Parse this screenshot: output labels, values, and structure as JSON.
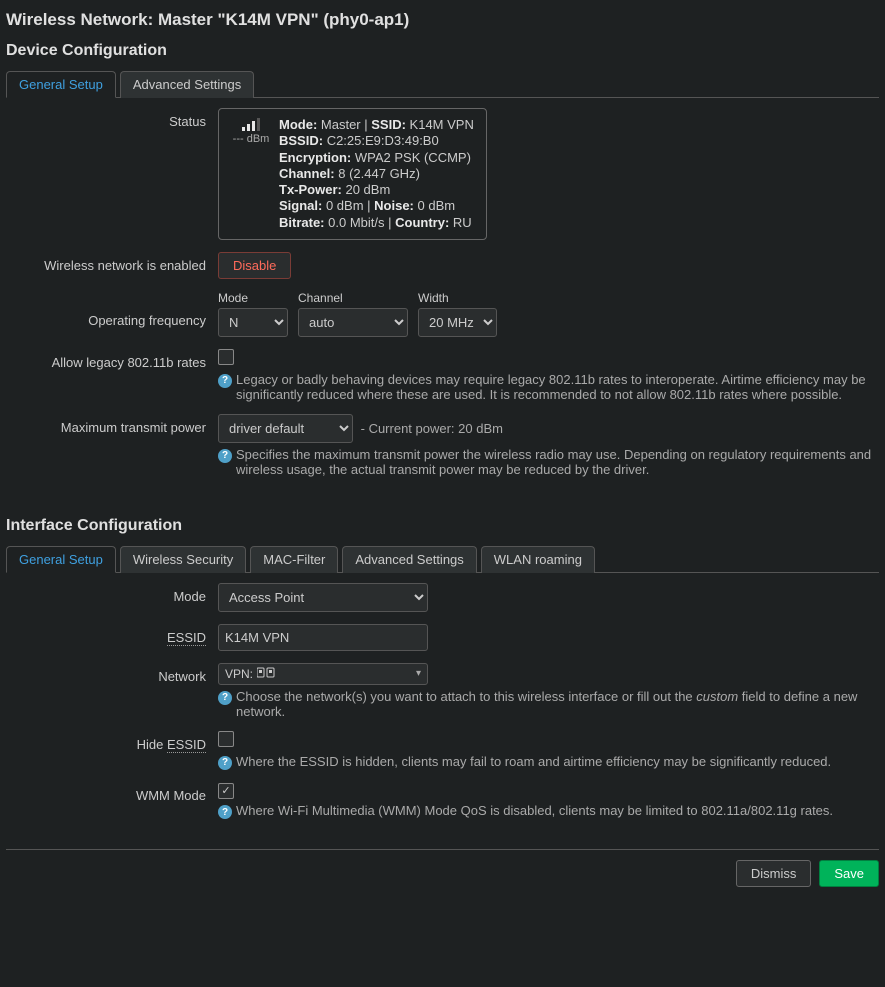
{
  "page": {
    "title": "Wireless Network: Master \"K14M VPN\" (phy0-ap1)"
  },
  "device": {
    "heading": "Device Configuration",
    "tabs": {
      "general": "General Setup",
      "advanced": "Advanced Settings"
    },
    "status": {
      "label": "Status",
      "signal_text": "--- dBm",
      "mode_k": "Mode:",
      "mode_v": "Master",
      "ssid_k": "SSID:",
      "ssid_v": "K14M VPN",
      "bssid_k": "BSSID:",
      "bssid_v": "C2:25:E9:D3:49:B0",
      "enc_k": "Encryption:",
      "enc_v": "WPA2 PSK (CCMP)",
      "chan_k": "Channel:",
      "chan_v": "8 (2.447 GHz)",
      "txp_k": "Tx-Power:",
      "txp_v": "20 dBm",
      "sig_k": "Signal:",
      "sig_v": "0 dBm",
      "noise_k": "Noise:",
      "noise_v": "0 dBm",
      "bit_k": "Bitrate:",
      "bit_v": "0.0 Mbit/s",
      "country_k": "Country:",
      "country_v": "RU"
    },
    "enabled": {
      "label": "Wireless network is enabled",
      "button": "Disable"
    },
    "freq": {
      "label": "Operating frequency",
      "mode_label": "Mode",
      "mode_value": "N",
      "channel_label": "Channel",
      "channel_value": "auto",
      "width_label": "Width",
      "width_value": "20 MHz"
    },
    "legacy": {
      "label": "Allow legacy 802.11b rates",
      "checked": false,
      "help": "Legacy or badly behaving devices may require legacy 802.11b rates to interoperate. Airtime efficiency may be significantly reduced where these are used. It is recommended to not allow 802.11b rates where possible."
    },
    "txpower": {
      "label": "Maximum transmit power",
      "value": "driver default",
      "current": "- Current power: 20 dBm",
      "help": "Specifies the maximum transmit power the wireless radio may use. Depending on regulatory requirements and wireless usage, the actual transmit power may be reduced by the driver."
    }
  },
  "iface": {
    "heading": "Interface Configuration",
    "tabs": {
      "general": "General Setup",
      "security": "Wireless Security",
      "mac": "MAC-Filter",
      "advanced": "Advanced Settings",
      "roaming": "WLAN roaming"
    },
    "mode": {
      "label": "Mode",
      "value": "Access Point"
    },
    "essid": {
      "label": "ESSID",
      "value": "K14M VPN"
    },
    "network": {
      "label": "Network",
      "value": "VPN:",
      "help_pre": "Choose the network(s) you want to attach to this wireless interface or fill out the ",
      "help_em": "custom",
      "help_post": " field to define a new network."
    },
    "hide": {
      "label": "Hide ",
      "label2": "ESSID",
      "checked": false,
      "help": "Where the ESSID is hidden, clients may fail to roam and airtime efficiency may be significantly reduced."
    },
    "wmm": {
      "label": "WMM Mode",
      "checked": true,
      "help": "Where Wi-Fi Multimedia (WMM) Mode QoS is disabled, clients may be limited to 802.11a/802.11g rates."
    }
  },
  "footer": {
    "dismiss": "Dismiss",
    "save": "Save"
  }
}
